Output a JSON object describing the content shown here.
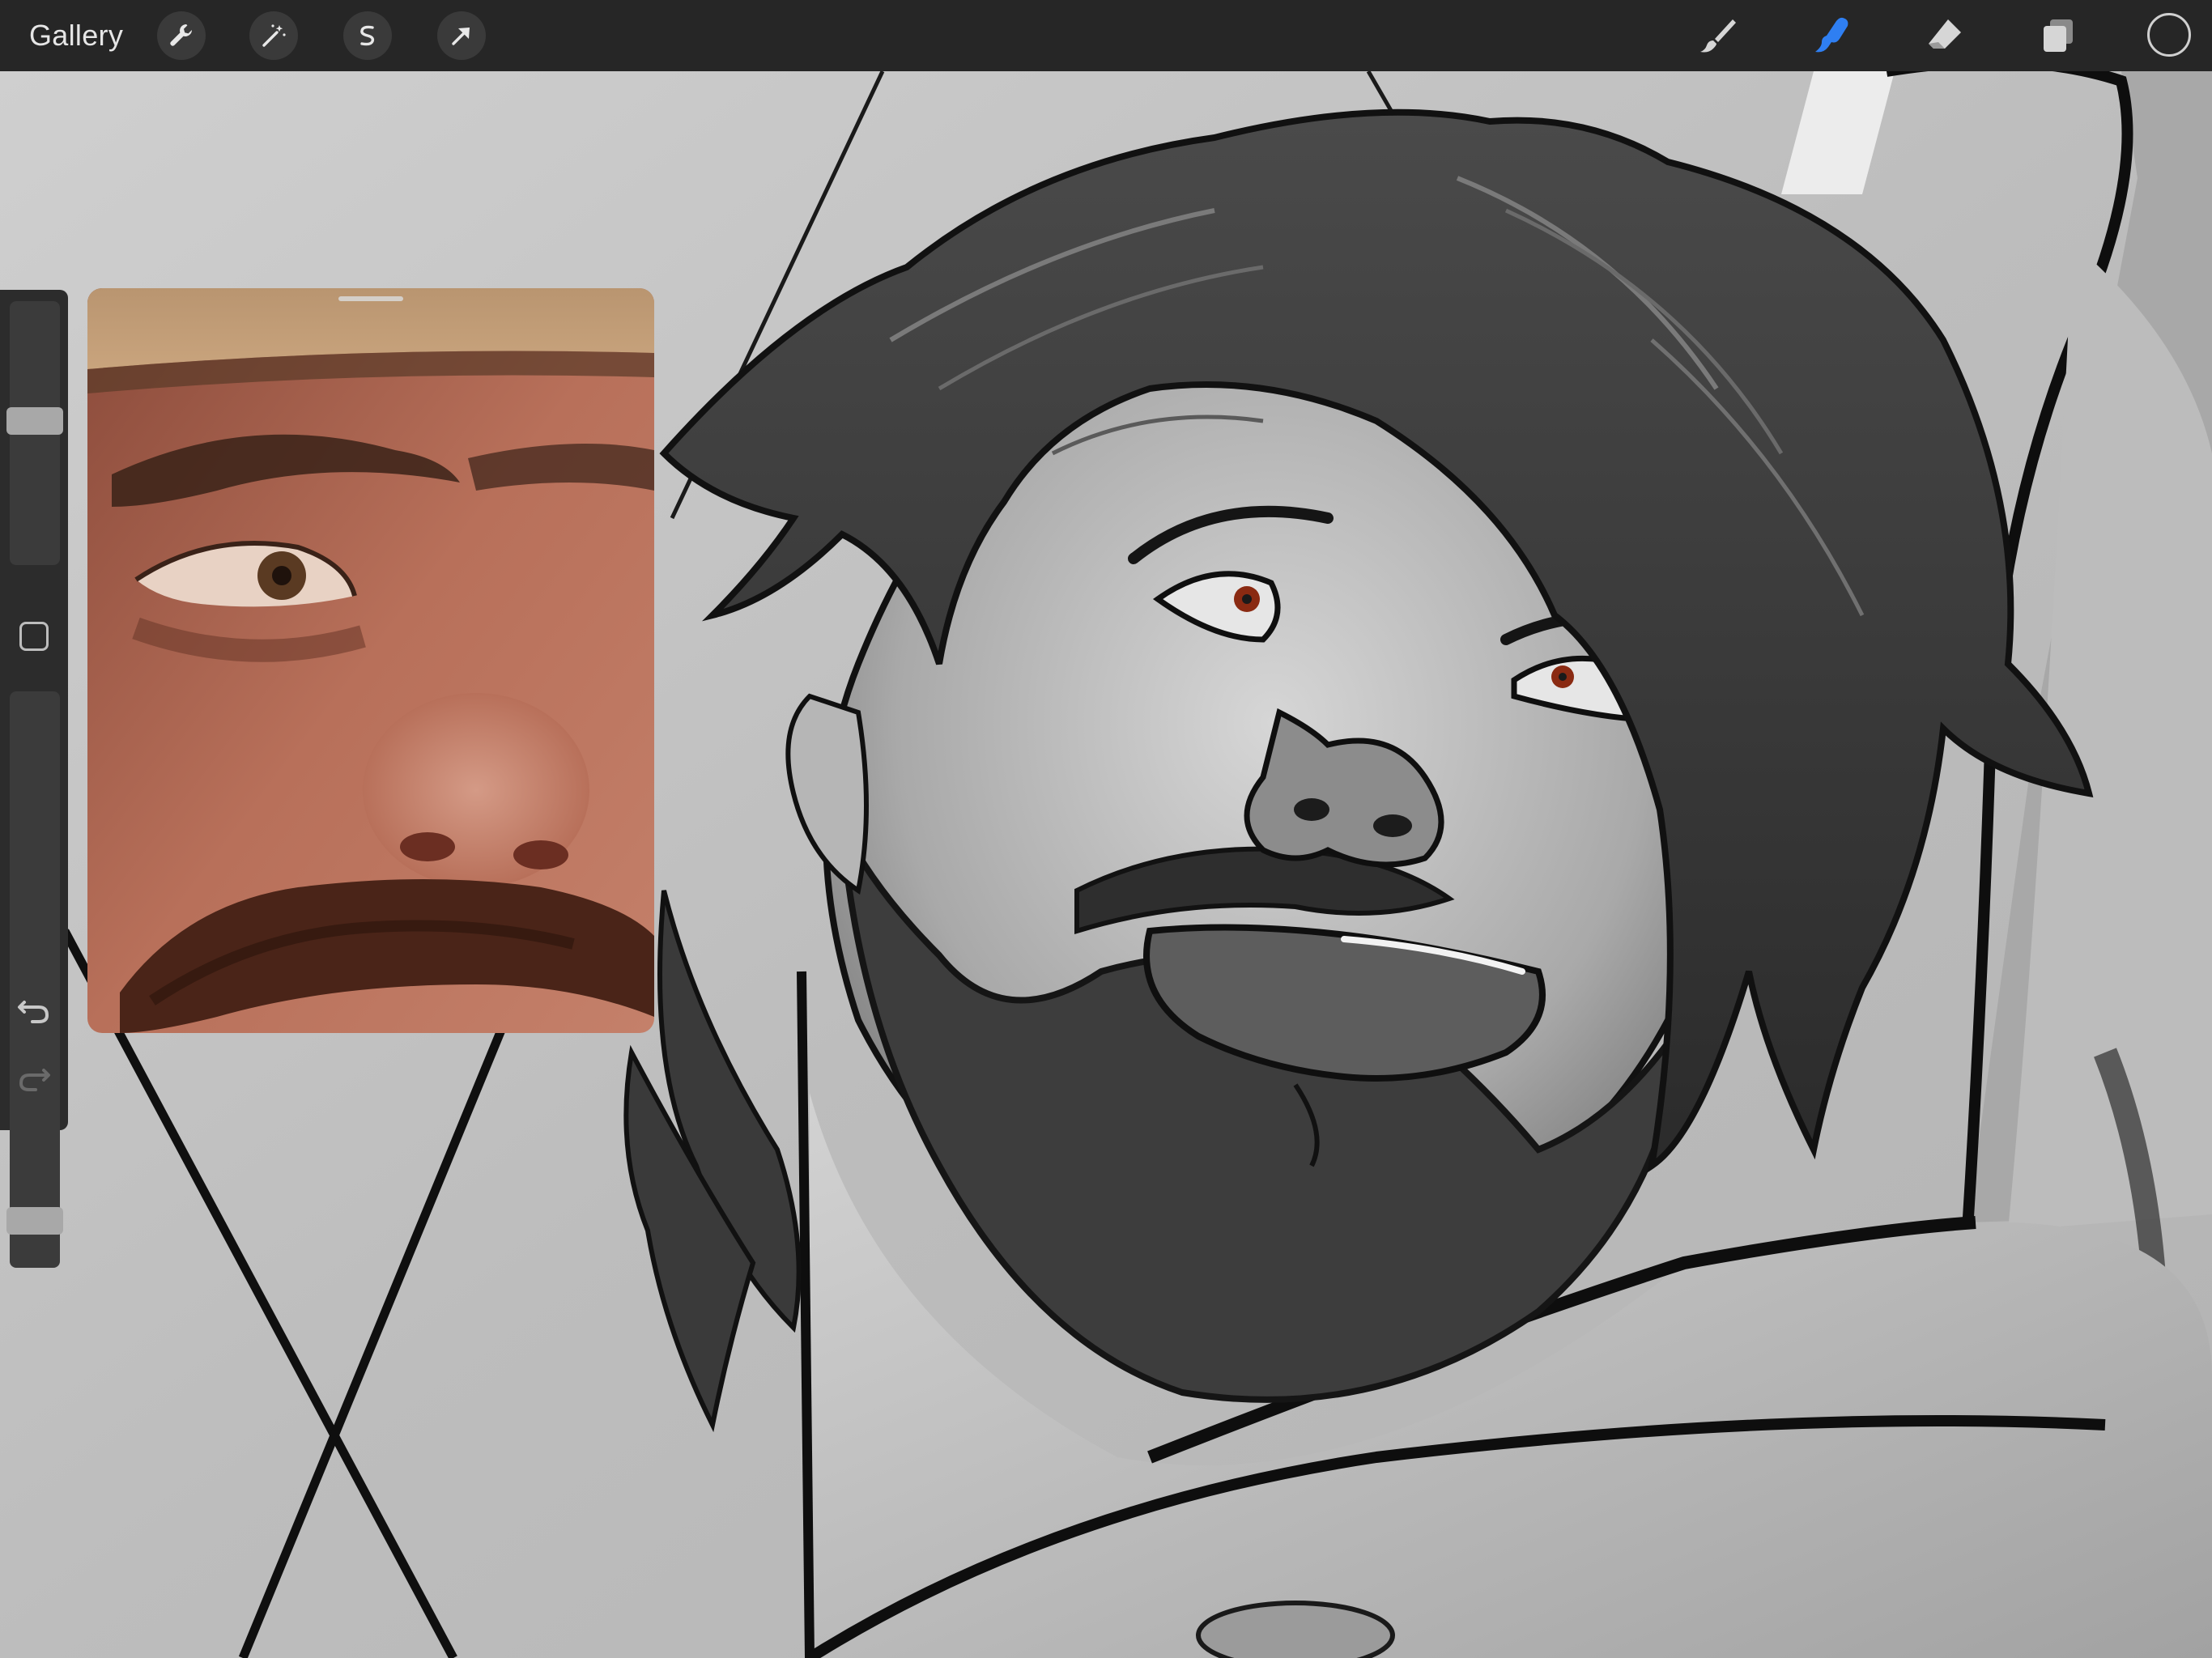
{
  "toolbar": {
    "gallery_label": "Gallery",
    "left_tools": [
      "wrench-icon",
      "magic-wand-icon",
      "selection-icon",
      "transform-arrow-icon"
    ],
    "right_tools": [
      "brush-icon",
      "smudge-icon",
      "eraser-icon",
      "layers-icon"
    ],
    "active_tool": "smudge-icon",
    "active_color": "#2f7ff2"
  },
  "sidebar": {
    "brush_size_level": 0.55,
    "opacity_level": 0.06,
    "buttons": [
      "modify-square-icon",
      "undo-icon",
      "redo-icon"
    ]
  },
  "reference_panel": {
    "content": "video-reference"
  }
}
